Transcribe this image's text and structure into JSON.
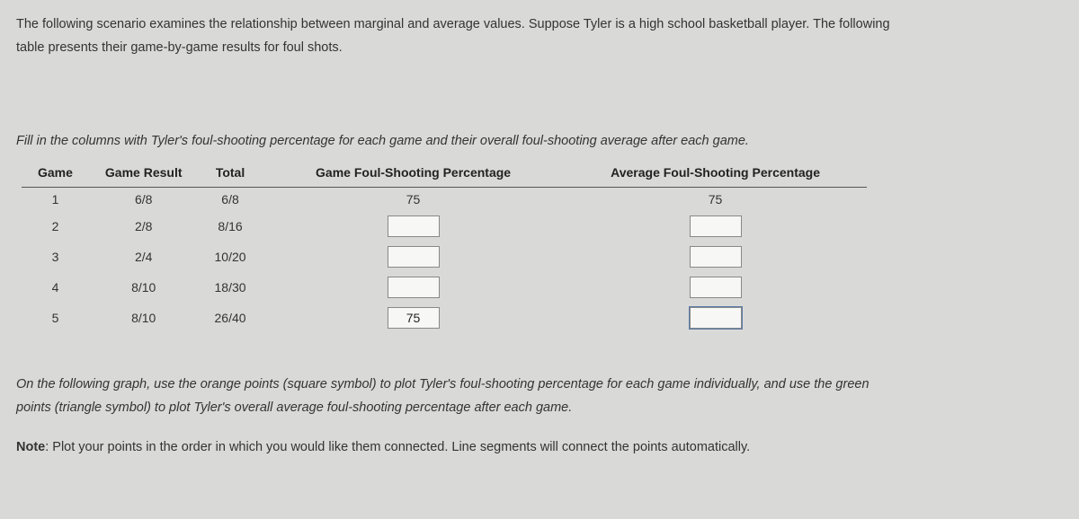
{
  "intro_line1": "The following scenario examines the relationship between marginal and average values. Suppose Tyler is a high school basketball player. The following",
  "intro_line2": "table presents their game-by-game results for foul shots.",
  "instruction": "Fill in the columns with Tyler's foul-shooting percentage for each game and their overall foul-shooting average after each game.",
  "headers": {
    "game": "Game",
    "result": "Game Result",
    "total": "Total",
    "game_pct": "Game Foul-Shooting Percentage",
    "avg_pct": "Average Foul-Shooting Percentage"
  },
  "rows": [
    {
      "game": "1",
      "result": "6/8",
      "total": "6/8",
      "game_pct": "75",
      "avg_pct": "75",
      "game_pct_input": false,
      "avg_pct_input": false
    },
    {
      "game": "2",
      "result": "2/8",
      "total": "8/16",
      "game_pct": "",
      "avg_pct": "",
      "game_pct_input": true,
      "avg_pct_input": true
    },
    {
      "game": "3",
      "result": "2/4",
      "total": "10/20",
      "game_pct": "",
      "avg_pct": "",
      "game_pct_input": true,
      "avg_pct_input": true
    },
    {
      "game": "4",
      "result": "8/10",
      "total": "18/30",
      "game_pct": "",
      "avg_pct": "",
      "game_pct_input": true,
      "avg_pct_input": true
    },
    {
      "game": "5",
      "result": "8/10",
      "total": "26/40",
      "game_pct": "75",
      "avg_pct": "",
      "game_pct_input": true,
      "avg_pct_input": true,
      "avg_focused": true
    }
  ],
  "graph_instruction_line1": "On the following graph, use the orange points (square symbol) to plot Tyler's foul-shooting percentage for each game individually, and use the green",
  "graph_instruction_line2": "points (triangle symbol) to plot Tyler's overall average foul-shooting percentage after each game.",
  "note_label": "Note",
  "note_text": ": Plot your points in the order in which you would like them connected. Line segments will connect the points automatically."
}
